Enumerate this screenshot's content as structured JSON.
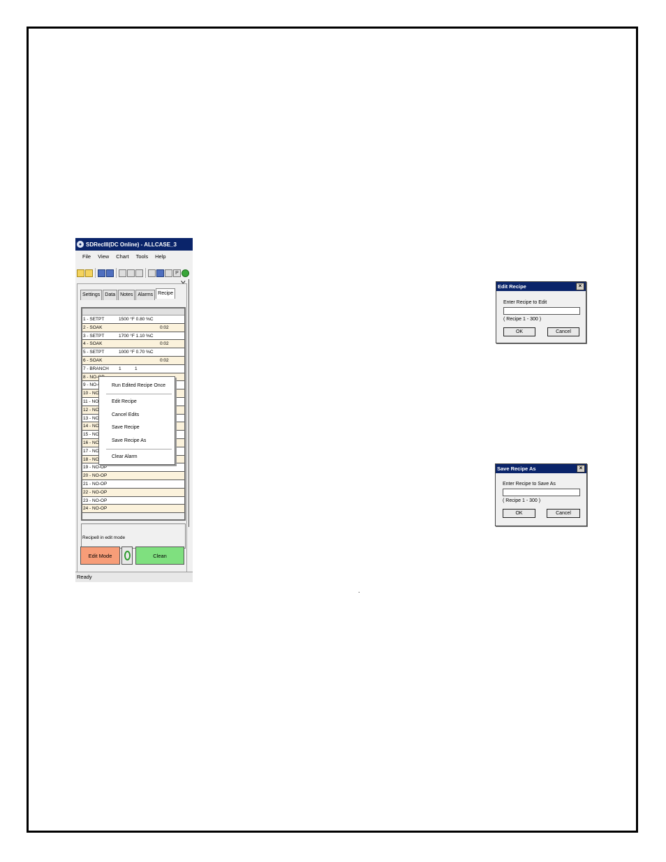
{
  "app": {
    "title": "SDRecIII(DC Online) - ALLCASE_3",
    "menu": [
      "File",
      "View",
      "Chart",
      "Tools",
      "Help"
    ],
    "close_label": "X",
    "tabs": [
      "Settings",
      "Data",
      "Notes",
      "Alarms",
      "Recipe"
    ],
    "active_tab": "Recipe",
    "recipe_rows": [
      {
        "name": "1 - SETPT",
        "v1": "1500 °F 0.80 %C",
        "v2": "",
        "v3": ""
      },
      {
        "name": "2 - SOAK",
        "v1": "",
        "v2": "",
        "v3": "0:02"
      },
      {
        "name": "3 - SETPT",
        "v1": "1700 °F 1.10 %C",
        "v2": "",
        "v3": ""
      },
      {
        "name": "4 - SOAK",
        "v1": "",
        "v2": "",
        "v3": "0:02"
      },
      {
        "name": "5 - SETPT",
        "v1": "1000 °F 0.70 %C",
        "v2": "",
        "v3": ""
      },
      {
        "name": "6 - SOAK",
        "v1": "",
        "v2": "",
        "v3": "0:02"
      },
      {
        "name": "7 - BRANCH",
        "v1": "1",
        "v2": "1",
        "v3": ""
      },
      {
        "name": "8 - NO-OP",
        "v1": "",
        "v2": "",
        "v3": ""
      },
      {
        "name": "9 - NO-OP",
        "v1": "",
        "v2": "",
        "v3": ""
      },
      {
        "name": "10 - NO-OP",
        "v1": "",
        "v2": "",
        "v3": ""
      },
      {
        "name": "11 - NO-OP",
        "v1": "",
        "v2": "",
        "v3": ""
      },
      {
        "name": "12 - NO-OP",
        "v1": "",
        "v2": "",
        "v3": ""
      },
      {
        "name": "13 - NO-OP",
        "v1": "",
        "v2": "",
        "v3": ""
      },
      {
        "name": "14 - NO-OP",
        "v1": "",
        "v2": "",
        "v3": ""
      },
      {
        "name": "15 - NO-OP",
        "v1": "",
        "v2": "",
        "v3": ""
      },
      {
        "name": "16 - NO-OP",
        "v1": "",
        "v2": "",
        "v3": ""
      },
      {
        "name": "17 - NO-OP",
        "v1": "",
        "v2": "",
        "v3": ""
      },
      {
        "name": "18 - NO-OP",
        "v1": "",
        "v2": "",
        "v3": ""
      },
      {
        "name": "19 - NO-OP",
        "v1": "",
        "v2": "",
        "v3": ""
      },
      {
        "name": "20 - NO-OP",
        "v1": "",
        "v2": "",
        "v3": ""
      },
      {
        "name": "21 - NO-OP",
        "v1": "",
        "v2": "",
        "v3": ""
      },
      {
        "name": "22 - NO-OP",
        "v1": "",
        "v2": "",
        "v3": ""
      },
      {
        "name": "23 - NO-OP",
        "v1": "",
        "v2": "",
        "v3": ""
      },
      {
        "name": "24 - NO-OP",
        "v1": "",
        "v2": "",
        "v3": ""
      }
    ],
    "status_message": "Recipe8 in edit mode",
    "edit_mode_label": "Edit Mode",
    "clean_label": "Clean",
    "statusbar": "Ready"
  },
  "context_menu": {
    "items": [
      "Run Edited Recipe Once",
      "Edit Recipe",
      "Cancel Edits",
      "Save Recipe",
      "Save Recipe As",
      "Clear Alarm"
    ]
  },
  "edit_dialog": {
    "title": "Edit Recipe",
    "prompt": "Enter Recipe to Edit",
    "value": "",
    "range": "( Recipe 1 - 300 )",
    "ok": "OK",
    "cancel": "Cancel",
    "close": "×"
  },
  "save_dialog": {
    "title": "Save Recipe As",
    "prompt": "Enter Recipe to Save As",
    "value": "",
    "range": "( Recipe 1 - 300 )",
    "ok": "OK",
    "cancel": "Cancel",
    "close": "×"
  },
  "stray_mark": "."
}
